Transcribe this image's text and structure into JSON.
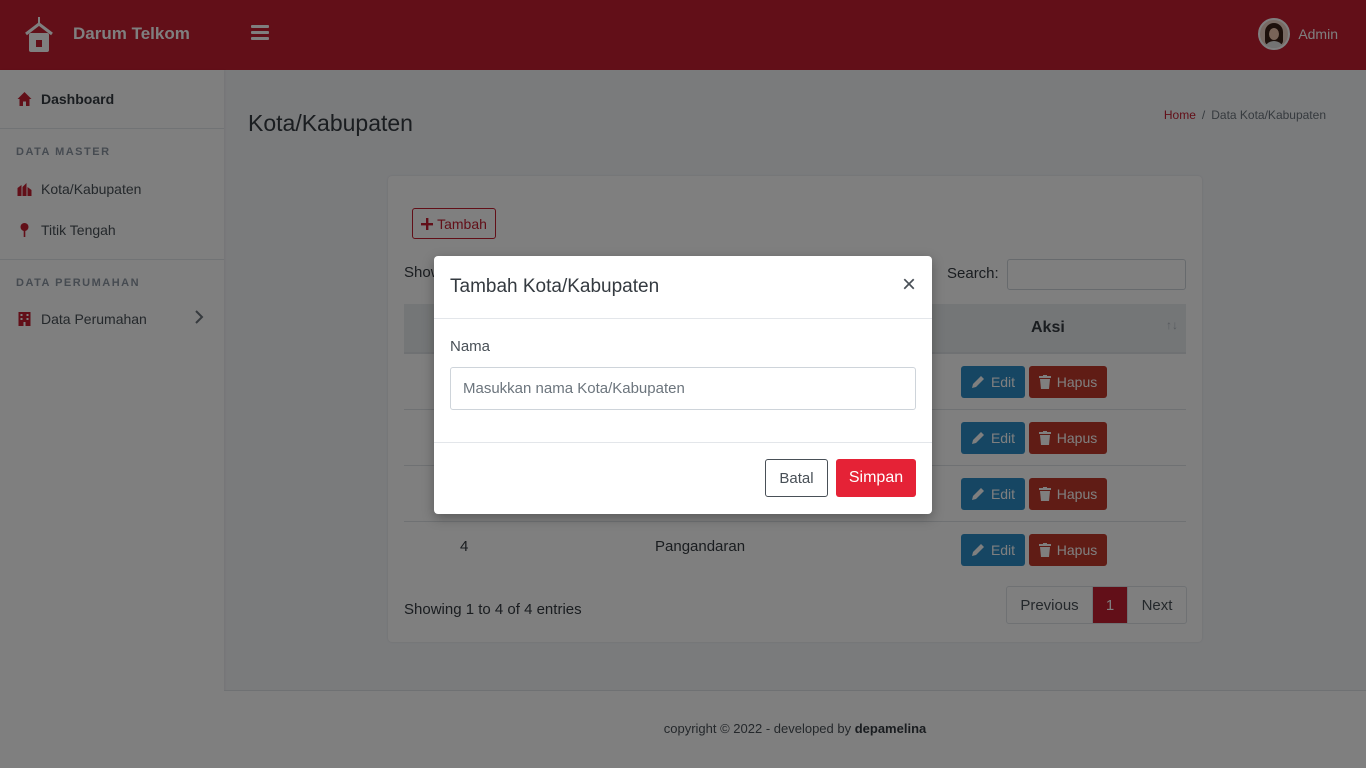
{
  "brand": {
    "name": "Darum Telkom"
  },
  "user": {
    "name": "Admin"
  },
  "sidebar": {
    "dashboard": "Dashboard",
    "section_master": "DATA MASTER",
    "kota": "Kota/Kabupaten",
    "titik": "Titik Tengah",
    "section_perumahan": "DATA PERUMAHAN",
    "perumahan": "Data Perumahan"
  },
  "page": {
    "title": "Kota/Kabupaten",
    "breadcrumb_home": "Home",
    "breadcrumb_sep": "/",
    "breadcrumb_current": "Data Kota/Kabupaten"
  },
  "table": {
    "add_button": "Tambah",
    "show_label": "Show",
    "search_label": "Search:",
    "column_aksi": "Aksi",
    "edit_label": "Edit",
    "hapus_label": "Hapus",
    "visible_row": {
      "no": "4",
      "nama": "Pangandaran"
    },
    "info": "Showing 1 to 4 of 4 entries",
    "pager_previous": "Previous",
    "pager_current": "1",
    "pager_next": "Next"
  },
  "footer": {
    "text": "copyright © 2022 - developed by ",
    "author": "depamelina"
  },
  "modal": {
    "title": "Tambah Kota/Kabupaten",
    "close": "×",
    "field_label": "Nama",
    "field_placeholder": "Masukkan nama Kota/Kabupaten",
    "field_value": "",
    "cancel": "Batal",
    "save": "Simpan"
  },
  "colors": {
    "primary": "#c41e30",
    "edit": "#2c8cc6",
    "hapus": "#c0392b",
    "simpan": "#e52236"
  }
}
